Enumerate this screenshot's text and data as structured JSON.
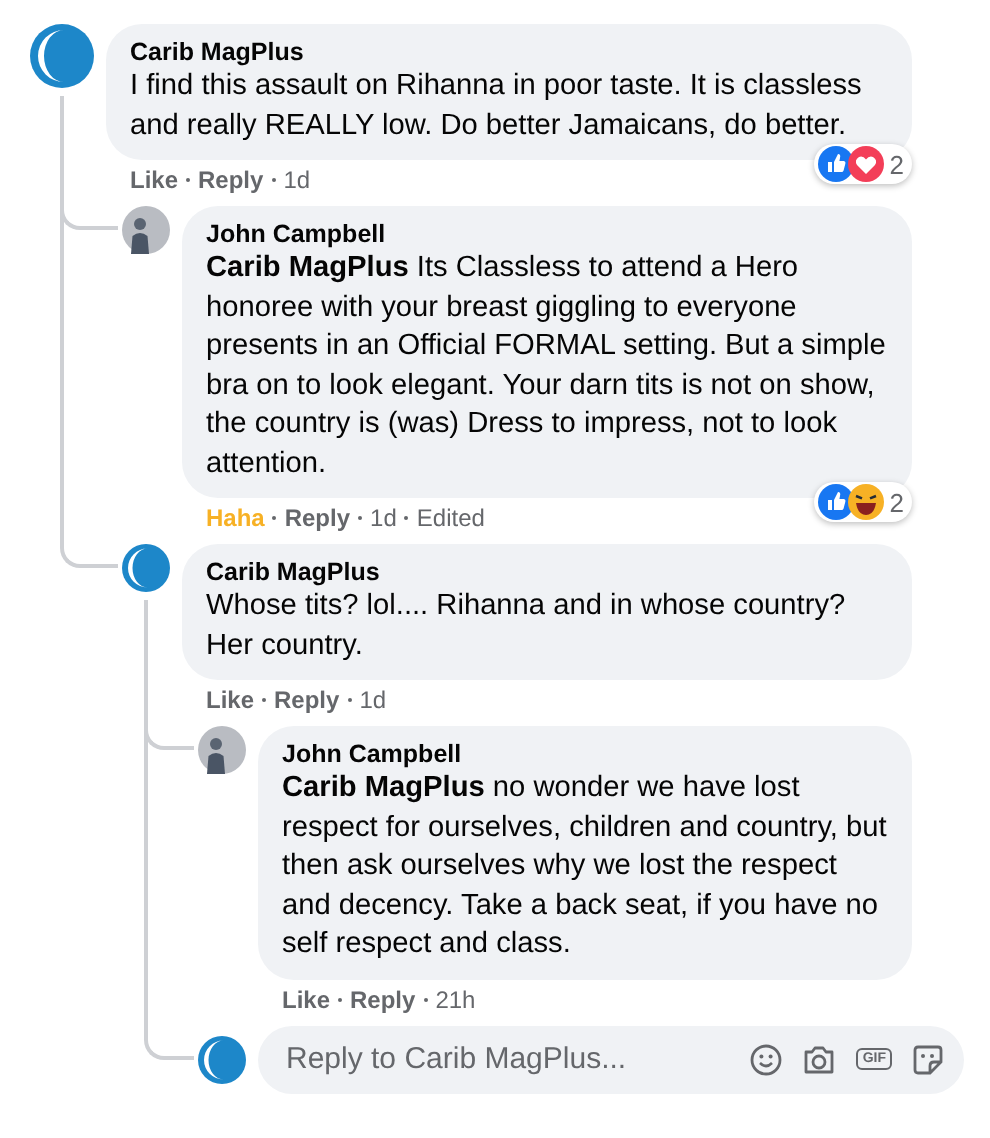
{
  "comments": [
    {
      "author": "Carib MagPlus",
      "avatar": {
        "kind": "logo"
      },
      "text": "I find this assault on Rihanna in poor taste. It is classless and really REALLY low. Do better Jamaicans, do better.",
      "reactions": {
        "icons": [
          {
            "kind": "like"
          },
          {
            "kind": "love"
          }
        ],
        "count": "2"
      },
      "react_action": {
        "label": "Like",
        "reacted": false
      },
      "reply_action": "Reply",
      "time": "1d",
      "replies": [
        {
          "author": "John Campbell",
          "avatar": {
            "kind": "person"
          },
          "text": "**Carib MagPlus** Its Classless to attend a Hero honoree with your breast giggling to everyone presents in an Official FORMAL setting. But a simple bra on to look elegant. Your darn tits is not on show, the country is (was) Dress to impress, not to look attention.",
          "reactions": {
            "icons": [
              {
                "kind": "like"
              },
              {
                "kind": "haha"
              }
            ],
            "count": "2"
          },
          "react_action": {
            "label": "Haha",
            "reacted": true
          },
          "reply_action": "Reply",
          "time": "1d",
          "edited": "Edited"
        },
        {
          "author": "Carib MagPlus",
          "avatar": {
            "kind": "logo"
          },
          "text": "Whose tits? lol.... Rihanna and in whose country? Her country.",
          "react_action": {
            "label": "Like",
            "reacted": false
          },
          "reply_action": "Reply",
          "time": "1d",
          "replies": [
            {
              "author": "John Campbell",
              "avatar": {
                "kind": "person"
              },
              "text": "**Carib MagPlus** no wonder we have lost respect for ourselves, children and country, but then ask ourselves why we lost the respect and decency. Take a back seat, if you have no self respect and class.",
              "react_action": {
                "label": "Like",
                "reacted": false
              },
              "reply_action": "Reply",
              "time": "21h"
            }
          ],
          "reply_box": {
            "avatar": {
              "kind": "logo"
            },
            "placeholder": "Reply to Carib MagPlus...",
            "gif_label": "GIF"
          }
        }
      ]
    }
  ]
}
